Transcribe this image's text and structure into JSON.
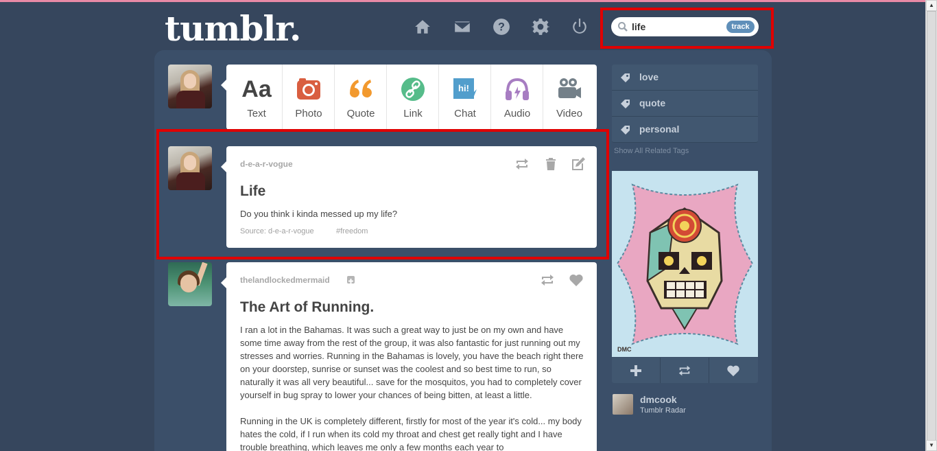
{
  "brand": {
    "logo_text": "tumblr."
  },
  "nav": {
    "icons": [
      "home-icon",
      "mail-icon",
      "help-icon",
      "gear-icon",
      "power-icon"
    ]
  },
  "search": {
    "value": "life",
    "track_label": "track"
  },
  "postbar": {
    "items": [
      {
        "label": "Text",
        "icon": "text-icon",
        "color": "#444444"
      },
      {
        "label": "Photo",
        "icon": "camera-icon",
        "color": "#d95e40"
      },
      {
        "label": "Quote",
        "icon": "quote-icon",
        "color": "#f2992e"
      },
      {
        "label": "Link",
        "icon": "link-icon",
        "color": "#56bc8a"
      },
      {
        "label": "Chat",
        "icon": "chat-icon",
        "color": "#529ecc"
      },
      {
        "label": "Audio",
        "icon": "headphones-icon",
        "color": "#a77dc2"
      },
      {
        "label": "Video",
        "icon": "video-camera-icon",
        "color": "#748089"
      }
    ]
  },
  "posts": [
    {
      "author": "d-e-a-r-vogue",
      "title": "Life",
      "body": "Do you think i kinda messed up my life?",
      "source": "Source: d-e-a-r-vogue",
      "tag": "#freedom"
    },
    {
      "author": "thelandlockedmermaid",
      "title": "The Art of Running.",
      "body": "I ran a lot in the Bahamas. It was such a great way to just be on my own and have some time away from the rest of the group, it was also fantastic for just running out my stresses and worries. Running in the Bahamas is lovely, you have the beach right there on your doorstep, sunrise or sunset was the coolest and so best time to run, so naturally it was all very beautiful... save for the mosquitos, you had to completely cover yourself in bug spray to lower your chances of being bitten, at least a little.",
      "body2": "Running in the UK is completely different, firstly for most of the year it's cold... my body hates the cold, if I run when its cold my throat and chest get really tight and I have trouble breathing, which leaves me only a few months each year to"
    }
  ],
  "related_tags": {
    "items": [
      "love",
      "quote",
      "personal"
    ],
    "show_all": "Show All Related Tags"
  },
  "radar": {
    "user": "dmcook",
    "subtitle": "Tumblr Radar",
    "image_signature": "DMC"
  },
  "colors": {
    "background": "#36465d",
    "highlight": "#e00000",
    "track_button": "#5f8fb9"
  }
}
